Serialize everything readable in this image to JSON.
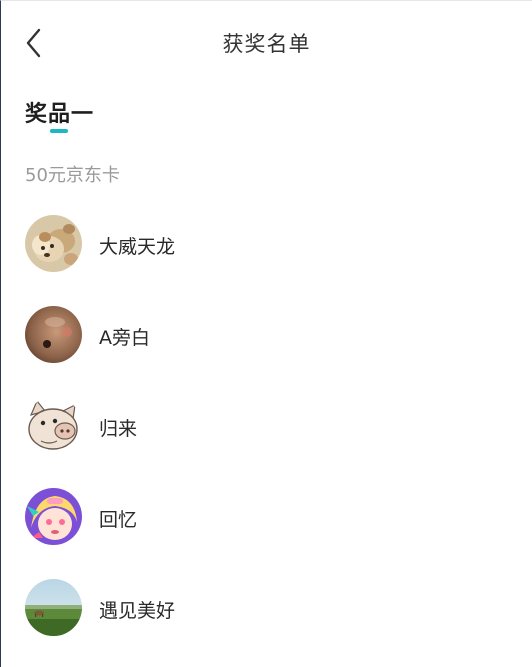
{
  "header": {
    "title": "获奖名单",
    "back_icon": "chevron-left-icon"
  },
  "prize": {
    "title": "奖品一",
    "subtitle": "50元京东卡",
    "accent_color": "#1bb7c3"
  },
  "winners": [
    {
      "name": "大威天龙",
      "avatar": "dog-avatar"
    },
    {
      "name": "A旁白",
      "avatar": "photo-avatar"
    },
    {
      "name": "归来",
      "avatar": "pig-avatar"
    },
    {
      "name": "回忆",
      "avatar": "anime-avatar"
    },
    {
      "name": "遇见美好",
      "avatar": "landscape-avatar"
    }
  ]
}
